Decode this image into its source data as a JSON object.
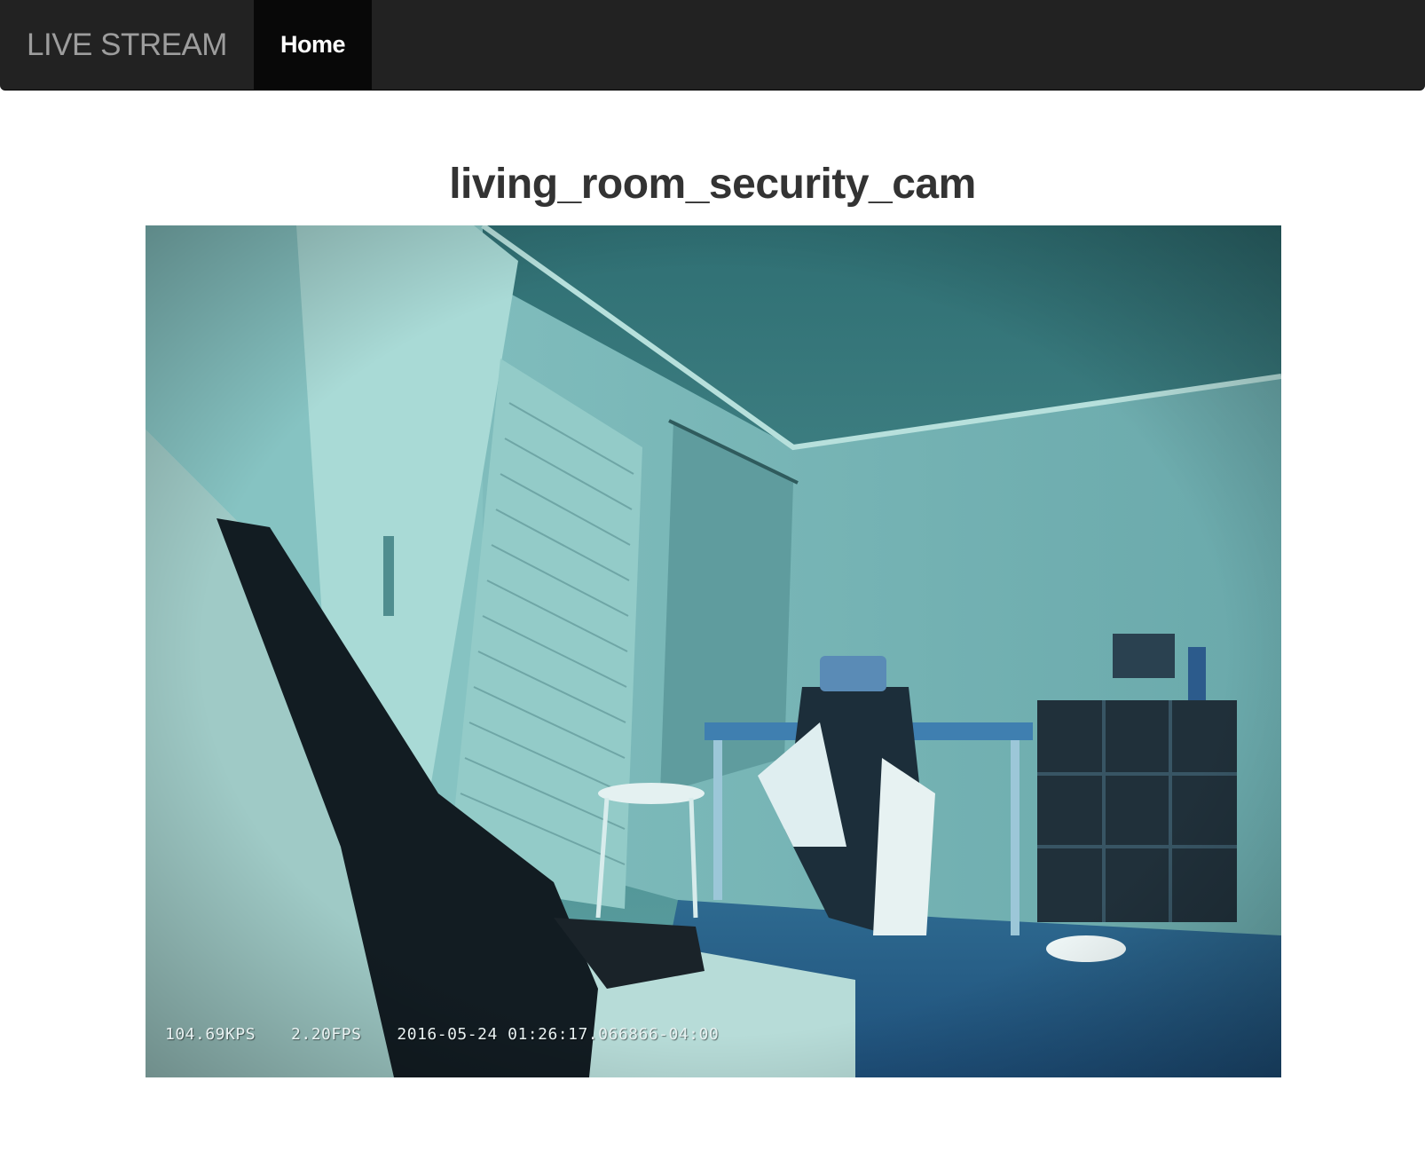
{
  "navbar": {
    "brand": "LIVE STREAM",
    "items": [
      {
        "label": "Home",
        "active": true
      }
    ]
  },
  "stream": {
    "title": "living_room_security_cam",
    "overlay": {
      "bitrate": "104.69KPS",
      "framerate": "2.20FPS",
      "timestamp": "2016-05-24 01:26:17.066866-04:00"
    }
  },
  "colors": {
    "navbar_bg": "#222222",
    "navbar_active_bg": "#080808",
    "brand_text": "#9d9d9d",
    "title_text": "#333333"
  }
}
